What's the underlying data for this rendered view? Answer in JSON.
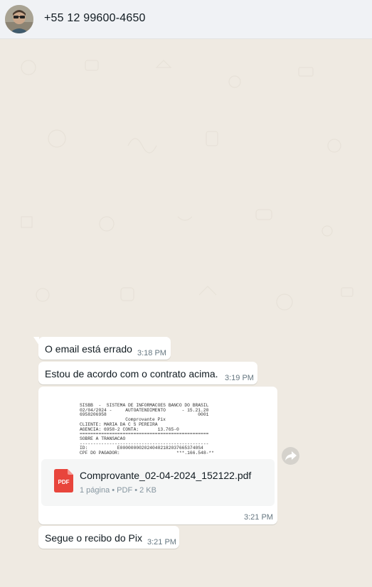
{
  "header": {
    "contact_name": "+55 12 99600-4650"
  },
  "messages": [
    {
      "text": "O email está errado",
      "time": "3:18 PM"
    },
    {
      "text": "Estou de acordo com o contrato acima.",
      "time": "3:19 PM"
    },
    {
      "type": "document",
      "preview_lines": [
        "SISBB  -  SISTEMA DE INFORMACOES BANCO DO BRASIL",
        "02/04/2024 -     AUTOATENDIMENTO      - 15.21.20",
        "6958206958                                  0001",
        "                 Comprovante Pix",
        "CLIENTE: MARIA DA C S PEREIRA",
        "AGENCIA: 6958-2 CONTA:       13.765-0",
        "================================================",
        "SOBRE A TRANSACAO",
        "------------------------------------------------",
        "ID:           E00000000202404021820376653740S4",
        "CPF DO PAGADOR:                     ***.166.548-**"
      ],
      "file_name": "Comprovante_02-04-2024_152122.pdf",
      "meta": "1 página • PDF • 2 KB",
      "icon_label": "PDF",
      "time": "3:21 PM"
    },
    {
      "text": "Segue o recibo do Pix",
      "time": "3:21 PM"
    }
  ],
  "colors": {
    "header_bg": "#f0f2f5",
    "chat_bg": "#efeae2",
    "bubble_bg": "#ffffff",
    "pdf_red": "#e8453c",
    "time_gray": "#667781"
  },
  "icons": {
    "avatar": "avatar",
    "pdf": "pdf-file-icon",
    "forward": "forward-icon"
  }
}
